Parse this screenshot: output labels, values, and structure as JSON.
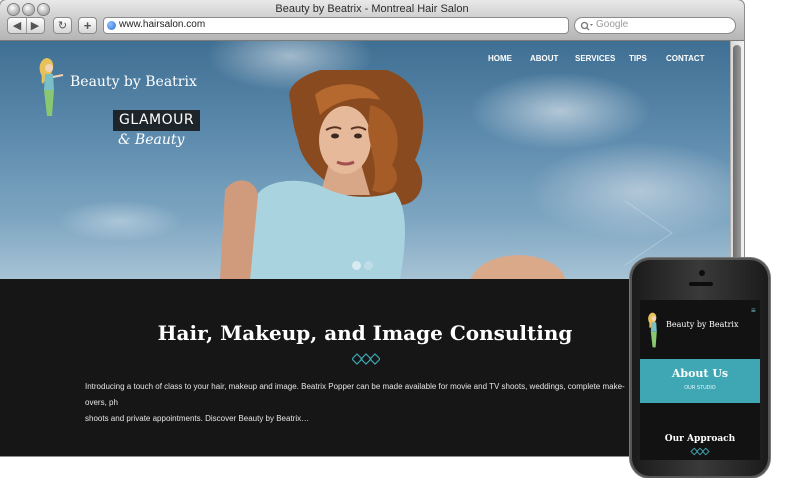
{
  "window": {
    "title": "Beauty by Beatrix - Montreal Hair Salon"
  },
  "toolbar": {
    "back_icon": "chevron-left-icon",
    "forward_icon": "chevron-right-icon",
    "reload_icon": "reload-icon",
    "add_icon": "plus-icon"
  },
  "address_bar": {
    "url": "www.hairsalon.com"
  },
  "search": {
    "placeholder": "Google"
  },
  "site": {
    "logo_text": "Beauty by Beatrix",
    "tagline_box": "GLAMOUR",
    "tagline_script": "& Beauty",
    "nav": [
      "HOME",
      "ABOUT",
      "SERVICES",
      "TIPS",
      "CONTACT"
    ],
    "accent_color": "#3fa6b3",
    "section_title": "Hair, Makeup, and Image Consulting",
    "section_text_line1": "Introducing a touch of class to your hair, makeup and image. Beatrix Popper can be made available for movie and TV shoots, weddings, complete make-overs, ph",
    "section_text_line2": "shoots and private appointments. Discover Beauty by Beatrix…"
  },
  "phone": {
    "logo_text": "Beauty by Beatrix",
    "menu_icon": "hamburger-icon",
    "about_title": "About Us",
    "about_subtitle": "OUR STUDIO",
    "approach_title": "Our Approach"
  }
}
